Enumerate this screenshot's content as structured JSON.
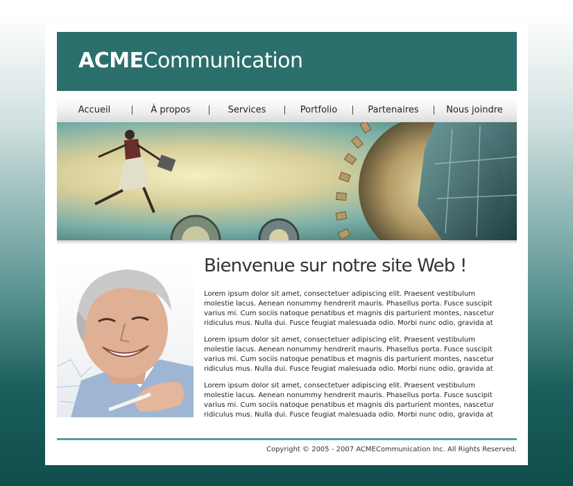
{
  "header": {
    "logo_bold": "ACME",
    "logo_light": "Communication",
    "bg_color": "#2a6f6c"
  },
  "nav": {
    "items": [
      {
        "label": "Accueil"
      },
      {
        "label": "À propos"
      },
      {
        "label": "Services"
      },
      {
        "label": "Portfolio"
      },
      {
        "label": "Partenaires"
      },
      {
        "label": "Nous joindre"
      }
    ]
  },
  "banner": {
    "icon": "business-woman-gears-illustration"
  },
  "main": {
    "photo_icon": "smiling-businessman-photo",
    "title": "Bienvenue sur notre site Web !",
    "paragraphs": [
      "Lorem ipsum dolor sit amet, consectetuer adipiscing elit. Praesent vestibulum molestie lacus. Aenean nonummy hendrerit mauris. Phasellus porta. Fusce suscipit varius mi. Cum sociis natoque penatibus et magnis dis parturient montes, nascetur ridiculus mus. Nulla dui. Fusce feugiat malesuada odio. Morbi nunc odio, gravida at",
      "Lorem ipsum dolor sit amet, consectetuer adipiscing elit. Praesent vestibulum molestie lacus. Aenean nonummy hendrerit mauris. Phasellus porta. Fusce suscipit varius mi. Cum sociis natoque penatibus et magnis dis parturient montes, nascetur ridiculus mus. Nulla dui. Fusce feugiat malesuada odio. Morbi nunc odio, gravida at",
      "Lorem ipsum dolor sit amet, consectetuer adipiscing elit. Praesent vestibulum molestie lacus. Aenean nonummy hendrerit mauris. Phasellus porta. Fusce suscipit varius mi. Cum sociis natoque penatibus et magnis dis parturient montes, nascetur ridiculus mus. Nulla dui. Fusce feugiat malesuada odio. Morbi nunc odio, gravida at"
    ]
  },
  "footer": {
    "copyright": "Copyright © 2005 - 2007 ACMECommunication Inc. All Rights Reserved.",
    "rule_color": "#5d9a97"
  }
}
